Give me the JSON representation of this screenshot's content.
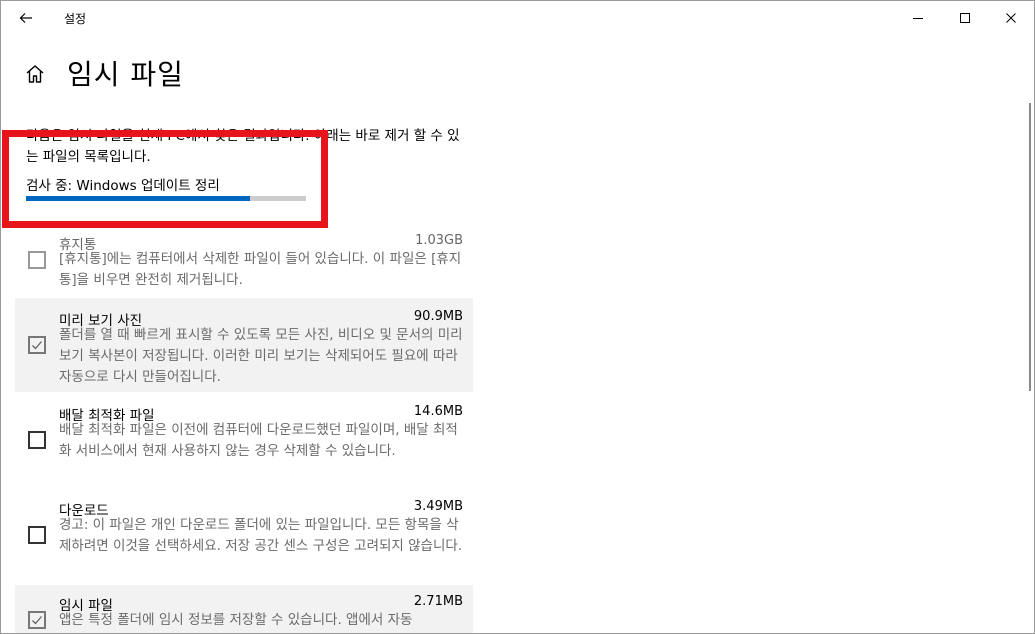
{
  "window": {
    "title": "설정"
  },
  "page": {
    "title": "임시 파일",
    "intro": "다음은 임시 파일을 현재 PC에서 찾은 결과입니다. 아래는 바로 제거 할 수 있는 파일의 목록입니다.",
    "scan_status": "검사 중: Windows 업데이트 정리",
    "progress_percent": 80
  },
  "items": [
    {
      "name": "휴지통",
      "size": "1.03GB",
      "checked": false,
      "selected": false,
      "desc": "[휴지통]에는 컴퓨터에서 삭제한 파일이 들어 있습니다. 이 파일은 [휴지통]을 비우면 완전히 제거됩니다."
    },
    {
      "name": "미리 보기 사진",
      "size": "90.9MB",
      "checked": true,
      "selected": true,
      "desc": "폴더를 열 때 빠르게 표시할 수 있도록 모든 사진, 비디오 및 문서의 미리 보기 복사본이 저장됩니다. 이러한 미리 보기는 삭제되어도 필요에 따라 자동으로 다시 만들어집니다."
    },
    {
      "name": "배달 최적화 파일",
      "size": "14.6MB",
      "checked": false,
      "selected": false,
      "desc": "배달 최적화 파일은 이전에 컴퓨터에 다운로드했던 파일이며, 배달 최적화 서비스에서 현재 사용하지 않는 경우 삭제할 수 있습니다."
    },
    {
      "name": "다운로드",
      "size": "3.49MB",
      "checked": false,
      "selected": false,
      "desc": "경고: 이 파일은 개인 다운로드 폴더에 있는 파일입니다. 모든 항목을 삭제하려면 이것을 선택하세요. 저장 공간 센스 구성은 고려되지 않습니다."
    },
    {
      "name": "임시 파일",
      "size": "2.71MB",
      "checked": true,
      "selected": true,
      "desc": "앱은 특정 폴더에 임시 정보를 저장할 수 있습니다. 앱에서 자동"
    }
  ],
  "colors": {
    "accent": "#0067c0",
    "highlight": "#e8141c"
  },
  "icons": {
    "back": "back-arrow-icon",
    "home": "home-icon",
    "minimize": "minimize-icon",
    "maximize": "maximize-icon",
    "close": "close-icon",
    "check": "checkmark-icon"
  }
}
